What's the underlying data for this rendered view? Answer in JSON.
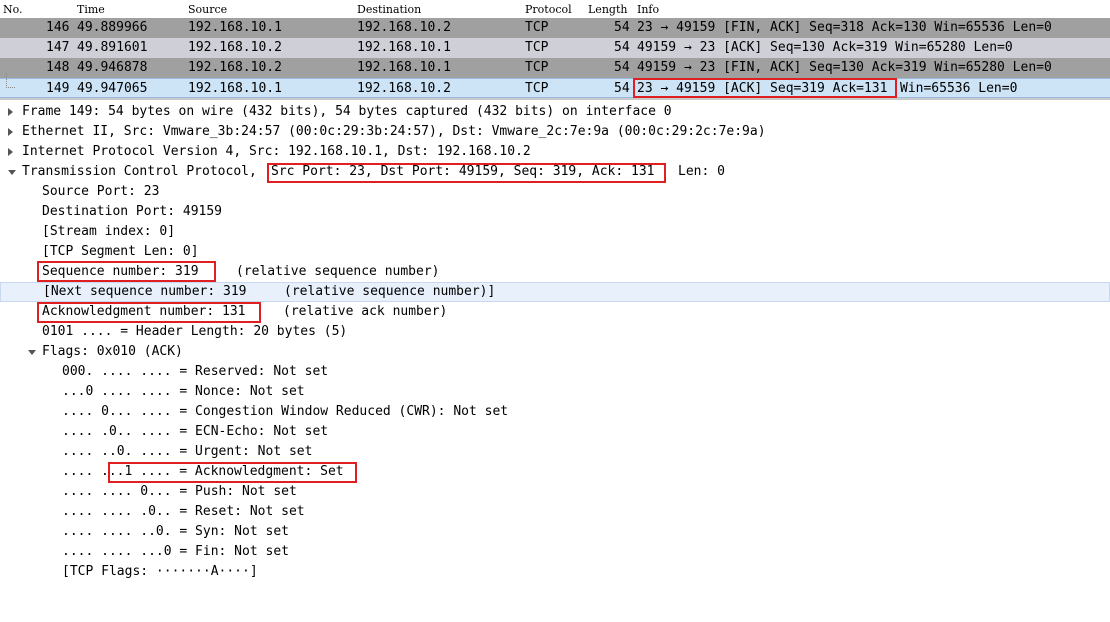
{
  "columns": {
    "no": "No.",
    "time": "Time",
    "source": "Source",
    "destination": "Destination",
    "protocol": "Protocol",
    "length": "Length",
    "info": "Info"
  },
  "colors": {
    "row_gray": "#a0a0a0",
    "row_gray_light": "#cfcfd8",
    "row_selected": "#cde4f7",
    "highlight": "#e02020",
    "detail_selected": "#e8f0fb"
  },
  "packets": [
    {
      "no": "146",
      "time": "49.889966",
      "source": "192.168.10.1",
      "destination": "192.168.10.2",
      "protocol": "TCP",
      "length": "54",
      "info": "23 → 49159 [FIN, ACK] Seq=318 Ack=130 Win=65536 Len=0"
    },
    {
      "no": "147",
      "time": "49.891601",
      "source": "192.168.10.2",
      "destination": "192.168.10.1",
      "protocol": "TCP",
      "length": "54",
      "info": "49159 → 23 [ACK] Seq=130 Ack=319 Win=65280 Len=0"
    },
    {
      "no": "148",
      "time": "49.946878",
      "source": "192.168.10.2",
      "destination": "192.168.10.1",
      "protocol": "TCP",
      "length": "54",
      "info": "49159 → 23 [FIN, ACK] Seq=130 Ack=319 Win=65280 Len=0"
    },
    {
      "no": "149",
      "time": "49.947065",
      "source": "192.168.10.1",
      "destination": "192.168.10.2",
      "protocol": "TCP",
      "length": "54",
      "info_boxed": "23 → 49159 [ACK] Seq=319 Ack=131",
      "info_rest": "Win=65536 Len=0"
    }
  ],
  "details": {
    "frame": "Frame 149: 54 bytes on wire (432 bits), 54 bytes captured (432 bits) on interface 0",
    "ethernet": "Ethernet II, Src: Vmware_3b:24:57 (00:0c:29:3b:24:57), Dst: Vmware_2c:7e:9a (00:0c:29:2c:7e:9a)",
    "ip": "Internet Protocol Version 4, Src: 192.168.10.1, Dst: 192.168.10.2",
    "tcp_prefix": "Transmission Control Protocol,",
    "tcp_boxed": "Src Port: 23, Dst Port: 49159, Seq: 319, Ack: 131",
    "tcp_suffix": "Len: 0",
    "src_port": "Source Port: 23",
    "dst_port": "Destination Port: 49159",
    "stream": "[Stream index: 0]",
    "seglen": "[TCP Segment Len: 0]",
    "seq_boxed": "Sequence number: 319",
    "seq_note": "(relative sequence number)",
    "next_seq": "[Next sequence number: 319",
    "next_seq_note": "(relative sequence number)]",
    "ack_boxed": "Acknowledgment number: 131",
    "ack_note": "(relative ack number)",
    "header_len": "0101 .... = Header Length: 20 bytes (5)",
    "flags": "Flags: 0x010 (ACK)",
    "f_reserved": "000. .... .... = Reserved: Not set",
    "f_nonce": "...0 .... .... = Nonce: Not set",
    "f_cwr": ".... 0... .... = Congestion Window Reduced (CWR): Not set",
    "f_ecn": ".... .0.. .... = ECN-Echo: Not set",
    "f_urgent": ".... ..0. .... = Urgent: Not set",
    "f_ack_pre": ".... ",
    "f_ack_boxed": "...1 .... = Acknowledgment: Set",
    "f_push": ".... .... 0... = Push: Not set",
    "f_reset": ".... .... .0.. = Reset: Not set",
    "f_syn": ".... .... ..0. = Syn: Not set",
    "f_fin": ".... .... ...0 = Fin: Not set",
    "tcp_flags": "[TCP Flags: ·······A····]"
  }
}
